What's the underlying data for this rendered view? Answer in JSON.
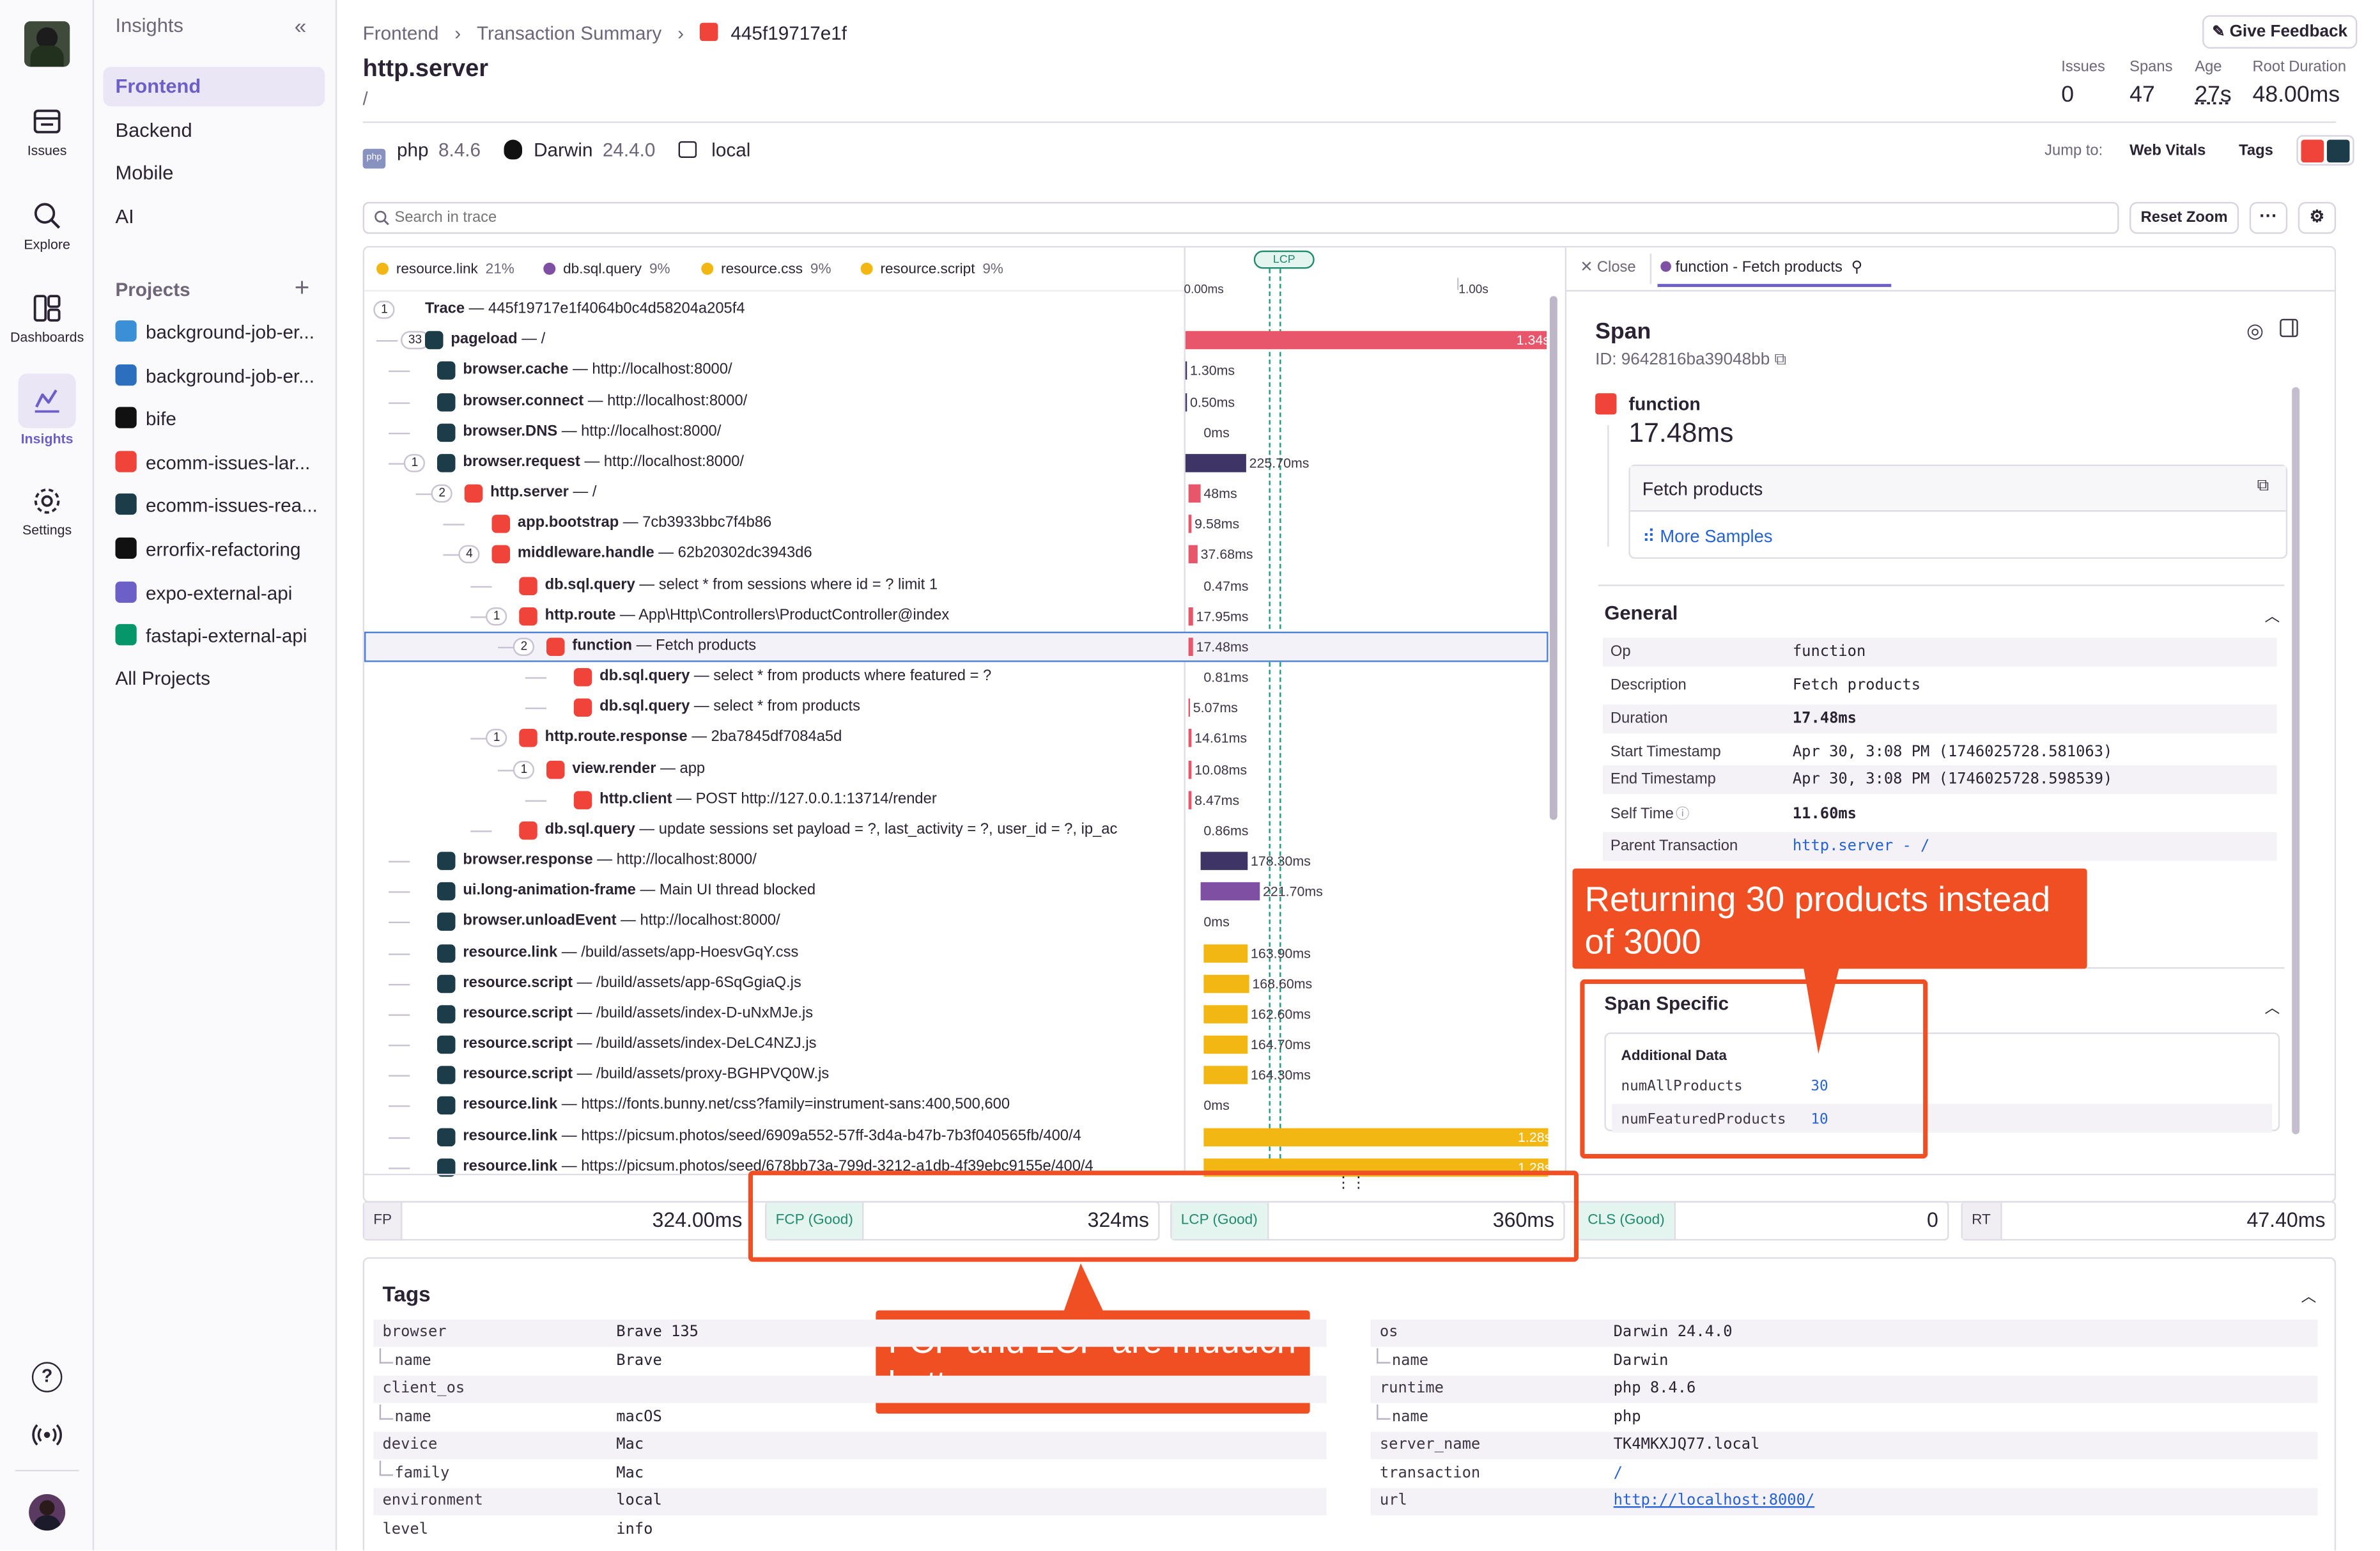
{
  "rail": {
    "items": [
      {
        "label": "Issues"
      },
      {
        "label": "Explore"
      },
      {
        "label": "Dashboards"
      },
      {
        "label": "Insights"
      },
      {
        "label": "Settings"
      }
    ]
  },
  "sidebar": {
    "title": "Insights",
    "sections": [
      "Frontend",
      "Backend",
      "Mobile",
      "AI"
    ],
    "projects_label": "Projects",
    "projects": [
      {
        "name": "background-job-er...",
        "color": "#3a8fd6"
      },
      {
        "name": "background-job-er...",
        "color": "#2d6fbf"
      },
      {
        "name": "bife",
        "color": "#111111"
      },
      {
        "name": "ecomm-issues-lar...",
        "color": "#f0433a"
      },
      {
        "name": "ecomm-issues-rea...",
        "color": "#1d3c4a"
      },
      {
        "name": "errorfix-refactoring",
        "color": "#111111"
      },
      {
        "name": "expo-external-api",
        "color": "#6c5fc7"
      },
      {
        "name": "fastapi-external-api",
        "color": "#059669"
      }
    ],
    "all_projects": "All Projects"
  },
  "header": {
    "breadcrumb": [
      "Frontend",
      "Transaction Summary",
      "445f19717e1f"
    ],
    "title": "http.server",
    "subtitle": "/",
    "feedback": "Give Feedback",
    "stats": [
      {
        "label": "Issues",
        "value": "0"
      },
      {
        "label": "Spans",
        "value": "47"
      },
      {
        "label": "Age",
        "value": "27s"
      },
      {
        "label": "Root Duration",
        "value": "48.00ms"
      }
    ],
    "platform": {
      "php_label": "php",
      "php_version": "8.4.6",
      "os_label": "Darwin",
      "os_version": "24.4.0",
      "env": "local"
    },
    "jump_to": "Jump to:",
    "jump_links": [
      "Web Vitals",
      "Tags"
    ]
  },
  "toolbar": {
    "search_placeholder": "Search in trace",
    "reset_zoom": "Reset Zoom",
    "more": "···"
  },
  "legend": [
    {
      "name": "resource.link",
      "pct": "21%",
      "color": "#f2b712"
    },
    {
      "name": "db.sql.query",
      "pct": "9%",
      "color": "#7f4fa3"
    },
    {
      "name": "resource.css",
      "pct": "9%",
      "color": "#f2b712"
    },
    {
      "name": "resource.script",
      "pct": "9%",
      "color": "#f2b712"
    }
  ],
  "timeline": {
    "t0": "0.00ms",
    "t1": "1.00s",
    "marker": "LCP"
  },
  "trace_rows": [
    {
      "cnt": "1",
      "op": "Trace",
      "desc": "445f19717e1f4064b0c4d58204a205f4",
      "ico": "",
      "dur": ""
    },
    {
      "cnt": "33",
      "op": "pageload",
      "desc": "/",
      "ico": "react",
      "dur": "1.34s"
    },
    {
      "cnt": "",
      "op": "browser.cache",
      "desc": "http://localhost:8000/",
      "ico": "react",
      "dur": "1.30ms"
    },
    {
      "cnt": "",
      "op": "browser.connect",
      "desc": "http://localhost:8000/",
      "ico": "react",
      "dur": "0.50ms"
    },
    {
      "cnt": "",
      "op": "browser.DNS",
      "desc": "http://localhost:8000/",
      "ico": "react",
      "dur": "0ms"
    },
    {
      "cnt": "1",
      "op": "browser.request",
      "desc": "http://localhost:8000/",
      "ico": "react",
      "dur": "225.70ms"
    },
    {
      "cnt": "2",
      "op": "http.server",
      "desc": "/",
      "ico": "laravel",
      "dur": "48ms"
    },
    {
      "cnt": "",
      "op": "app.bootstrap",
      "desc": "7cb3933bbc7f4b86",
      "ico": "laravel",
      "dur": "9.58ms"
    },
    {
      "cnt": "4",
      "op": "middleware.handle",
      "desc": "62b20302dc3943d6",
      "ico": "laravel",
      "dur": "37.68ms"
    },
    {
      "cnt": "",
      "op": "db.sql.query",
      "desc": "select * from sessions where id = ? limit 1",
      "ico": "laravel",
      "dur": "0.47ms"
    },
    {
      "cnt": "1",
      "op": "http.route",
      "desc": "App\\Http\\Controllers\\ProductController@index",
      "ico": "laravel",
      "dur": "17.95ms"
    },
    {
      "cnt": "2",
      "op": "function",
      "desc": "Fetch products",
      "ico": "laravel",
      "dur": "17.48ms"
    },
    {
      "cnt": "",
      "op": "db.sql.query",
      "desc": "select * from products where featured = ?",
      "ico": "laravel",
      "dur": "0.81ms"
    },
    {
      "cnt": "",
      "op": "db.sql.query",
      "desc": "select * from products",
      "ico": "laravel",
      "dur": "5.07ms"
    },
    {
      "cnt": "1",
      "op": "http.route.response",
      "desc": "2ba7845df7084a5d",
      "ico": "laravel",
      "dur": "14.61ms"
    },
    {
      "cnt": "1",
      "op": "view.render",
      "desc": "app",
      "ico": "laravel",
      "dur": "10.08ms"
    },
    {
      "cnt": "",
      "op": "http.client",
      "desc": "POST http://127.0.0.1:13714/render",
      "ico": "laravel",
      "dur": "8.47ms"
    },
    {
      "cnt": "",
      "op": "db.sql.query",
      "desc": "update sessions set payload = ?, last_activity = ?, user_id = ?, ip_ac",
      "ico": "laravel",
      "dur": "0.86ms"
    },
    {
      "cnt": "",
      "op": "browser.response",
      "desc": "http://localhost:8000/",
      "ico": "react",
      "dur": "178.30ms"
    },
    {
      "cnt": "",
      "op": "ui.long-animation-frame",
      "desc": "Main UI thread blocked",
      "ico": "react",
      "dur": "221.70ms"
    },
    {
      "cnt": "",
      "op": "browser.unloadEvent",
      "desc": "http://localhost:8000/",
      "ico": "react",
      "dur": "0ms"
    },
    {
      "cnt": "",
      "op": "resource.link",
      "desc": "/build/assets/app-HoesvGqY.css",
      "ico": "react",
      "dur": "163.90ms"
    },
    {
      "cnt": "",
      "op": "resource.script",
      "desc": "/build/assets/app-6SqGgiaQ.js",
      "ico": "react",
      "dur": "168.60ms"
    },
    {
      "cnt": "",
      "op": "resource.script",
      "desc": "/build/assets/index-D-uNxMJe.js",
      "ico": "react",
      "dur": "162.60ms"
    },
    {
      "cnt": "",
      "op": "resource.script",
      "desc": "/build/assets/index-DeLC4NZJ.js",
      "ico": "react",
      "dur": "164.70ms"
    },
    {
      "cnt": "",
      "op": "resource.script",
      "desc": "/build/assets/proxy-BGHPVQ0W.js",
      "ico": "react",
      "dur": "164.30ms"
    },
    {
      "cnt": "",
      "op": "resource.link",
      "desc": "https://fonts.bunny.net/css?family=instrument-sans:400,500,600",
      "ico": "react",
      "dur": "0ms"
    },
    {
      "cnt": "",
      "op": "resource.link",
      "desc": "https://picsum.photos/seed/6909a552-57ff-3d4a-b47b-7b3f040565fb/400/4",
      "ico": "react",
      "dur": "1.28s"
    },
    {
      "cnt": "",
      "op": "resource.link",
      "desc": "https://picsum.photos/seed/678bb73a-799d-3212-a1db-4f39ebc9155e/400/4",
      "ico": "react",
      "dur": "1.28s"
    }
  ],
  "panel": {
    "close": "Close",
    "tab": "function - Fetch products",
    "heading": "Span",
    "id_label": "ID: 9642816ba39048bb",
    "op": "function",
    "duration": "17.48ms",
    "description": "Fetch products",
    "more_samples": "More Samples",
    "general_title": "General",
    "general": [
      {
        "k": "Op",
        "v": "function"
      },
      {
        "k": "Description",
        "v": "Fetch products"
      },
      {
        "k": "Duration",
        "v": "17.48ms"
      },
      {
        "k": "Start Timestamp",
        "v": "Apr 30, 3:08 PM (1746025728.581063)"
      },
      {
        "k": "End Timestamp",
        "v": "Apr 30, 3:08 PM (1746025728.598539)"
      },
      {
        "k": "Self Time",
        "v": "11.60ms"
      },
      {
        "k": "Parent Transaction",
        "v": "http.server - /"
      }
    ],
    "span_specific_title": "Span Specific",
    "additional_data_title": "Additional Data",
    "additional": [
      {
        "k": "numAllProducts",
        "v": "30"
      },
      {
        "k": "numFeaturedProducts",
        "v": "10"
      }
    ]
  },
  "vitals": [
    {
      "label": "FP",
      "value": "324.00ms",
      "good": false
    },
    {
      "label": "FCP (Good)",
      "value": "324ms",
      "good": true
    },
    {
      "label": "LCP (Good)",
      "value": "360ms",
      "good": true
    },
    {
      "label": "CLS (Good)",
      "value": "0",
      "good": true
    },
    {
      "label": "RT",
      "value": "47.40ms",
      "good": false
    }
  ],
  "tags": {
    "title": "Tags",
    "left": [
      {
        "k": "browser",
        "v": "Brave 135",
        "child": false
      },
      {
        "k": "name",
        "v": "Brave",
        "child": true
      },
      {
        "k": "client_os",
        "v": "",
        "child": false
      },
      {
        "k": "name",
        "v": "macOS",
        "child": true
      },
      {
        "k": "device",
        "v": "Mac",
        "child": false
      },
      {
        "k": "family",
        "v": "Mac",
        "child": true
      },
      {
        "k": "environment",
        "v": "local",
        "child": false
      },
      {
        "k": "level",
        "v": "info",
        "child": false
      }
    ],
    "right": [
      {
        "k": "os",
        "v": "Darwin 24.4.0",
        "child": false
      },
      {
        "k": "name",
        "v": "Darwin",
        "child": true
      },
      {
        "k": "runtime",
        "v": "php 8.4.6",
        "child": false
      },
      {
        "k": "name",
        "v": "php",
        "child": true
      },
      {
        "k": "server_name",
        "v": "TK4MKXJQ77.local",
        "child": false
      },
      {
        "k": "transaction",
        "v": "/",
        "child": false
      },
      {
        "k": "url",
        "v": "http://localhost:8000/",
        "child": false
      }
    ]
  },
  "annotations": {
    "span_callout": "Returning 30 products instead of 3000",
    "vitals_callout": "FCP and LCP are muuuch better"
  },
  "colors": {
    "accent": "#6c5fc7",
    "annotation": "#f04e23",
    "laravel": "#f0433a",
    "react": "#1d3c4a",
    "resource": "#f2b712"
  }
}
